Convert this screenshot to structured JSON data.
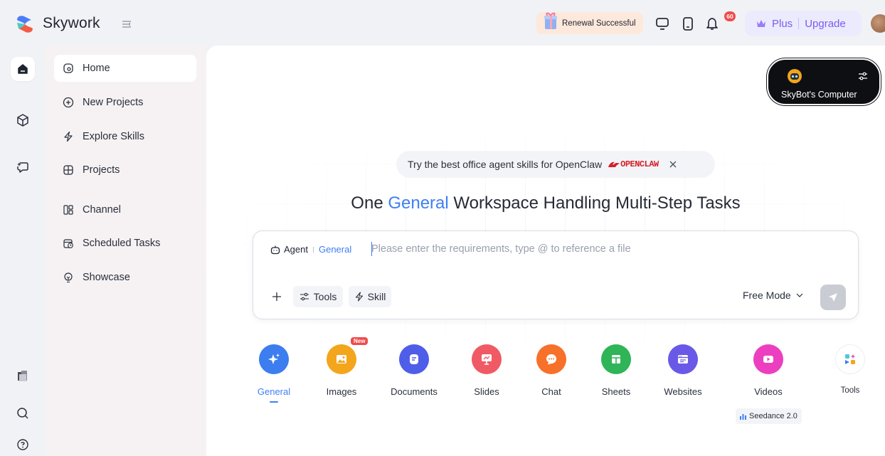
{
  "app": {
    "brand": "Skywork"
  },
  "header": {
    "renewal": "Renewal Successful",
    "notification_count": "60",
    "plus_label": "Plus",
    "upgrade_label": "Upgrade"
  },
  "sidebar": {
    "items": [
      {
        "label": "Home",
        "icon": "home-icon"
      },
      {
        "label": "New Projects",
        "icon": "plus-circle-icon"
      },
      {
        "label": "Explore Skills",
        "icon": "bolt-icon"
      },
      {
        "label": "Projects",
        "icon": "projects-icon"
      },
      {
        "label": "Channel",
        "icon": "channel-icon"
      },
      {
        "label": "Scheduled Tasks",
        "icon": "calendar-clock-icon"
      },
      {
        "label": "Showcase",
        "icon": "lightbulb-icon"
      }
    ]
  },
  "main": {
    "skybot_label": "SkyBot's Computer",
    "promo_text": "Try the best office agent skills for OpenClaw",
    "promo_brand": "OPENCLAW",
    "headline_before": "One ",
    "headline_accent": "General",
    "headline_after": " Workspace Handling Multi-Step Tasks",
    "composer": {
      "agent_label": "Agent",
      "agent_mode": "General",
      "placeholder": "Please enter the requirements, type @ to reference a file",
      "value": "",
      "tools_label": "Tools",
      "skill_label": "Skill",
      "mode_label": "Free Mode"
    },
    "categories": [
      {
        "label": "General",
        "icon": "sparkle-icon",
        "color": "#3c7df0"
      },
      {
        "label": "Images",
        "icon": "image-icon",
        "color": "#f3a51c",
        "badge": "New"
      },
      {
        "label": "Documents",
        "icon": "document-icon",
        "color": "#4f5ee8"
      },
      {
        "label": "Slides",
        "icon": "presentation-icon",
        "color": "#f05a64"
      },
      {
        "label": "Chat",
        "icon": "chat-icon",
        "color": "#f7712a"
      },
      {
        "label": "Sheets",
        "icon": "table-icon",
        "color": "#2fb457"
      },
      {
        "label": "Websites",
        "icon": "browser-icon",
        "color": "#6a59e6"
      },
      {
        "label": "Videos",
        "icon": "video-icon",
        "color": "#ec3fc0"
      },
      {
        "label": "Tools",
        "icon": "tools-grid-icon",
        "color": "#ffffff"
      }
    ],
    "seedance_label": "Seedance 2.0"
  },
  "colors": {
    "accent": "#3f7ff4",
    "plus_purple": "#7b5cf0",
    "badge_red": "#f04b4b",
    "sidebar_bg": "#f6f2f3"
  }
}
